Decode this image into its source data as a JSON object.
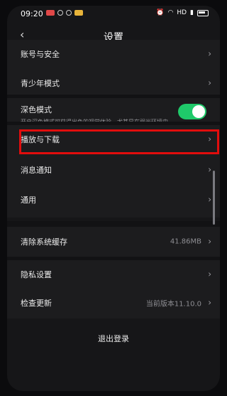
{
  "status_bar": {
    "time": "09:20",
    "indicators": [
      "HD"
    ]
  },
  "header": {
    "title": "设置",
    "back_label": "‹"
  },
  "settings": {
    "account_security": "账号与安全",
    "teen_mode": "青少年模式",
    "dark_mode": {
      "label": "深色模式",
      "description": "开启深色模式可获得出色的视觉体验，尤其是在弱光环境中",
      "enabled": true
    },
    "play_download": "播放与下载",
    "notifications": "消息通知",
    "general": "通用",
    "clear_cache": {
      "label": "清除系统缓存",
      "value": "41.86MB"
    },
    "privacy": "隐私设置",
    "check_update": {
      "label": "检查更新",
      "value": "当前版本11.10.0"
    },
    "logout": "退出登录"
  },
  "colors": {
    "accent_toggle": "#1fc96a",
    "highlight": "#e10d0d"
  },
  "icons": [
    "back-chevron-icon",
    "chevron-right-icon",
    "battery-icon",
    "wifi-icon"
  ]
}
